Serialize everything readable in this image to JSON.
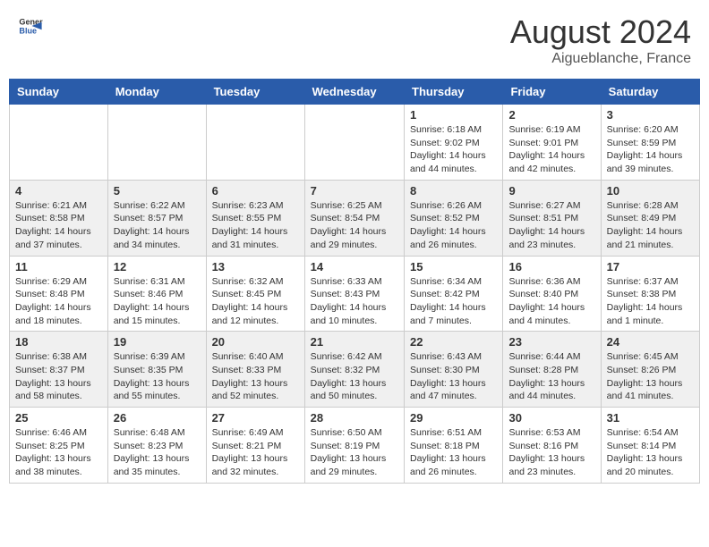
{
  "logo": {
    "general": "General",
    "blue": "Blue"
  },
  "title": "August 2024",
  "subtitle": "Aigueblanche, France",
  "days_of_week": [
    "Sunday",
    "Monday",
    "Tuesday",
    "Wednesday",
    "Thursday",
    "Friday",
    "Saturday"
  ],
  "weeks": [
    {
      "shaded": false,
      "days": [
        {
          "num": "",
          "info": ""
        },
        {
          "num": "",
          "info": ""
        },
        {
          "num": "",
          "info": ""
        },
        {
          "num": "",
          "info": ""
        },
        {
          "num": "1",
          "info": "Sunrise: 6:18 AM\nSunset: 9:02 PM\nDaylight: 14 hours and 44 minutes."
        },
        {
          "num": "2",
          "info": "Sunrise: 6:19 AM\nSunset: 9:01 PM\nDaylight: 14 hours and 42 minutes."
        },
        {
          "num": "3",
          "info": "Sunrise: 6:20 AM\nSunset: 8:59 PM\nDaylight: 14 hours and 39 minutes."
        }
      ]
    },
    {
      "shaded": true,
      "days": [
        {
          "num": "4",
          "info": "Sunrise: 6:21 AM\nSunset: 8:58 PM\nDaylight: 14 hours and 37 minutes."
        },
        {
          "num": "5",
          "info": "Sunrise: 6:22 AM\nSunset: 8:57 PM\nDaylight: 14 hours and 34 minutes."
        },
        {
          "num": "6",
          "info": "Sunrise: 6:23 AM\nSunset: 8:55 PM\nDaylight: 14 hours and 31 minutes."
        },
        {
          "num": "7",
          "info": "Sunrise: 6:25 AM\nSunset: 8:54 PM\nDaylight: 14 hours and 29 minutes."
        },
        {
          "num": "8",
          "info": "Sunrise: 6:26 AM\nSunset: 8:52 PM\nDaylight: 14 hours and 26 minutes."
        },
        {
          "num": "9",
          "info": "Sunrise: 6:27 AM\nSunset: 8:51 PM\nDaylight: 14 hours and 23 minutes."
        },
        {
          "num": "10",
          "info": "Sunrise: 6:28 AM\nSunset: 8:49 PM\nDaylight: 14 hours and 21 minutes."
        }
      ]
    },
    {
      "shaded": false,
      "days": [
        {
          "num": "11",
          "info": "Sunrise: 6:29 AM\nSunset: 8:48 PM\nDaylight: 14 hours and 18 minutes."
        },
        {
          "num": "12",
          "info": "Sunrise: 6:31 AM\nSunset: 8:46 PM\nDaylight: 14 hours and 15 minutes."
        },
        {
          "num": "13",
          "info": "Sunrise: 6:32 AM\nSunset: 8:45 PM\nDaylight: 14 hours and 12 minutes."
        },
        {
          "num": "14",
          "info": "Sunrise: 6:33 AM\nSunset: 8:43 PM\nDaylight: 14 hours and 10 minutes."
        },
        {
          "num": "15",
          "info": "Sunrise: 6:34 AM\nSunset: 8:42 PM\nDaylight: 14 hours and 7 minutes."
        },
        {
          "num": "16",
          "info": "Sunrise: 6:36 AM\nSunset: 8:40 PM\nDaylight: 14 hours and 4 minutes."
        },
        {
          "num": "17",
          "info": "Sunrise: 6:37 AM\nSunset: 8:38 PM\nDaylight: 14 hours and 1 minute."
        }
      ]
    },
    {
      "shaded": true,
      "days": [
        {
          "num": "18",
          "info": "Sunrise: 6:38 AM\nSunset: 8:37 PM\nDaylight: 13 hours and 58 minutes."
        },
        {
          "num": "19",
          "info": "Sunrise: 6:39 AM\nSunset: 8:35 PM\nDaylight: 13 hours and 55 minutes."
        },
        {
          "num": "20",
          "info": "Sunrise: 6:40 AM\nSunset: 8:33 PM\nDaylight: 13 hours and 52 minutes."
        },
        {
          "num": "21",
          "info": "Sunrise: 6:42 AM\nSunset: 8:32 PM\nDaylight: 13 hours and 50 minutes."
        },
        {
          "num": "22",
          "info": "Sunrise: 6:43 AM\nSunset: 8:30 PM\nDaylight: 13 hours and 47 minutes."
        },
        {
          "num": "23",
          "info": "Sunrise: 6:44 AM\nSunset: 8:28 PM\nDaylight: 13 hours and 44 minutes."
        },
        {
          "num": "24",
          "info": "Sunrise: 6:45 AM\nSunset: 8:26 PM\nDaylight: 13 hours and 41 minutes."
        }
      ]
    },
    {
      "shaded": false,
      "days": [
        {
          "num": "25",
          "info": "Sunrise: 6:46 AM\nSunset: 8:25 PM\nDaylight: 13 hours and 38 minutes."
        },
        {
          "num": "26",
          "info": "Sunrise: 6:48 AM\nSunset: 8:23 PM\nDaylight: 13 hours and 35 minutes."
        },
        {
          "num": "27",
          "info": "Sunrise: 6:49 AM\nSunset: 8:21 PM\nDaylight: 13 hours and 32 minutes."
        },
        {
          "num": "28",
          "info": "Sunrise: 6:50 AM\nSunset: 8:19 PM\nDaylight: 13 hours and 29 minutes."
        },
        {
          "num": "29",
          "info": "Sunrise: 6:51 AM\nSunset: 8:18 PM\nDaylight: 13 hours and 26 minutes."
        },
        {
          "num": "30",
          "info": "Sunrise: 6:53 AM\nSunset: 8:16 PM\nDaylight: 13 hours and 23 minutes."
        },
        {
          "num": "31",
          "info": "Sunrise: 6:54 AM\nSunset: 8:14 PM\nDaylight: 13 hours and 20 minutes."
        }
      ]
    }
  ]
}
